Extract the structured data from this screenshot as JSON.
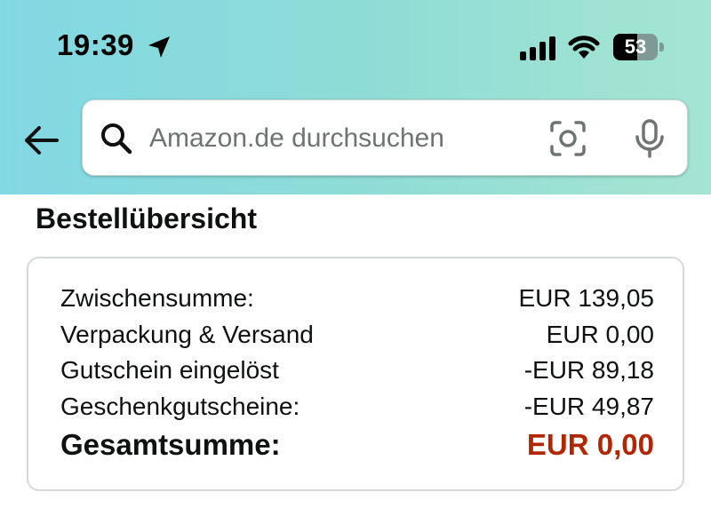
{
  "status_bar": {
    "time": "19:39",
    "battery_level": "53",
    "battery_fraction": 0.53
  },
  "search": {
    "placeholder": "Amazon.de durchsuchen"
  },
  "order_summary": {
    "title": "Bestellübersicht",
    "rows": [
      {
        "label": "Zwischensumme:",
        "value": "EUR 139,05"
      },
      {
        "label": "Verpackung & Versand",
        "value": "EUR 0,00"
      },
      {
        "label": "Gutschein eingelöst",
        "value": "-EUR 89,18"
      },
      {
        "label": "Geschenkgutscheine:",
        "value": "-EUR 49,87"
      }
    ],
    "total": {
      "label": "Gesamtsumme:",
      "value": "EUR 0,00"
    }
  },
  "colors": {
    "header_gradient_start": "#82d8e3",
    "header_gradient_end": "#a5e5d2",
    "total_price": "#b12704",
    "card_border": "#d5d9d9"
  },
  "icons": [
    "location-arrow-icon",
    "cellular-signal-icon",
    "wifi-icon",
    "battery-icon",
    "back-arrow-icon",
    "search-icon",
    "camera-lens-icon",
    "microphone-icon"
  ]
}
